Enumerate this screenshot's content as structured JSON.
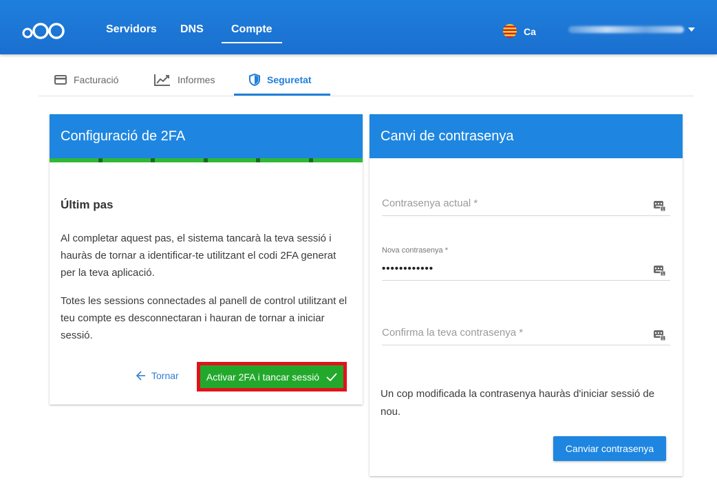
{
  "topnav": {
    "items": [
      {
        "label": "Servidors"
      },
      {
        "label": "DNS"
      },
      {
        "label": "Compte",
        "active": true
      }
    ],
    "language": "Ca",
    "user_blurred": true
  },
  "subtabs": [
    {
      "label": "Facturació",
      "icon": "credit-card-icon"
    },
    {
      "label": "Informes",
      "icon": "chart-line-icon"
    },
    {
      "label": "Seguretat",
      "icon": "shield-icon",
      "active": true
    }
  ],
  "twofa_card": {
    "title": "Configuració de 2FA",
    "progress": 1.0,
    "step_title": "Últim pas",
    "paragraph1": "Al completar aquest pas, el sistema tancarà la teva sessió i hauràs de tornar a identificar-te utilitzant el codi 2FA generat per la teva aplicació.",
    "paragraph2": "Totes les sessions connectades al panell de control utilitzant el teu compte es desconnectaran i hauran de tornar a iniciar sessió.",
    "back_label": "Tornar",
    "activate_label": "Activar 2FA i tancar sessió"
  },
  "password_card": {
    "title": "Canvi de contrasenya",
    "current_placeholder": "Contrasenya actual *",
    "new_label": "Nova contrasenya *",
    "new_value": "••••••••••••",
    "confirm_placeholder": "Confirma la teva contrasenya *",
    "info": "Un cop modificada la contrasenya hauràs d'iniciar sessió de nou.",
    "button_label": "Canviar contrasenya"
  },
  "colors": {
    "primary": "#1e86e0",
    "success": "#22a92c",
    "highlight": "#e0131b"
  }
}
